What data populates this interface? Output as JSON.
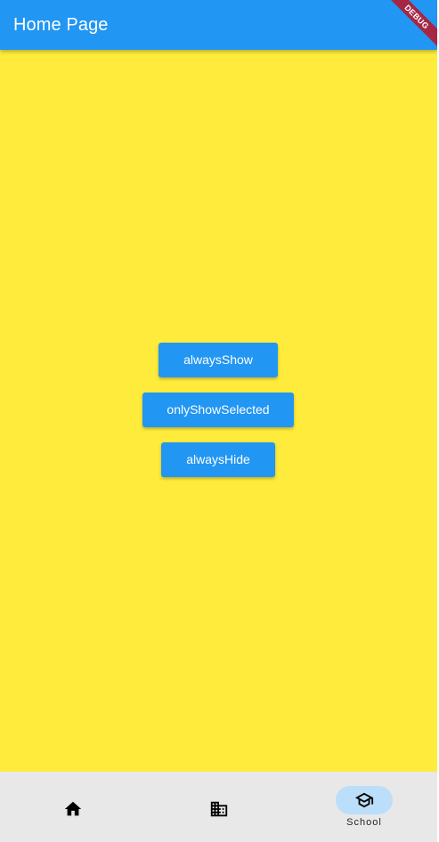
{
  "app_bar": {
    "title": "Home Page",
    "background_color": "#2196f3"
  },
  "debug_banner": {
    "label": "DEBUG",
    "color": "#a52745"
  },
  "body": {
    "background_color": "#ffeb3b",
    "buttons": [
      {
        "label": "alwaysShow"
      },
      {
        "label": "onlyShowSelected"
      },
      {
        "label": "alwaysHide"
      }
    ]
  },
  "bottom_nav": {
    "background_color": "#e8e8e8",
    "indicator_color": "#bbdefb",
    "items": [
      {
        "icon": "home-icon",
        "label": "",
        "selected": false
      },
      {
        "icon": "business-icon",
        "label": "",
        "selected": false
      },
      {
        "icon": "school-icon",
        "label": "School",
        "selected": true
      }
    ]
  }
}
